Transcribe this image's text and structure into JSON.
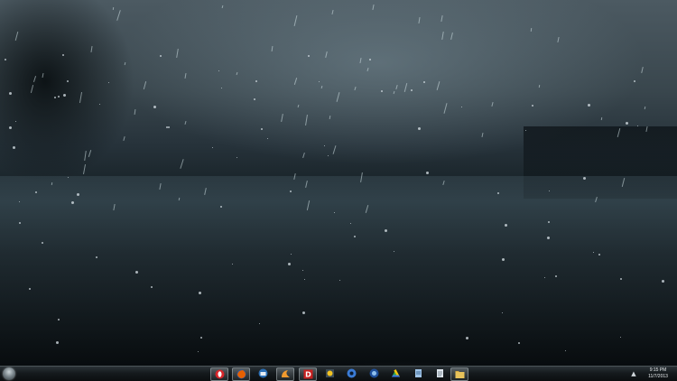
{
  "desktop": {
    "wallpaper": "rain-on-pavement-photo"
  },
  "taskbar": {
    "start_icon": "windows-orb-icon",
    "apps": [
      {
        "name": "opera",
        "icon": "opera-icon",
        "color": "#d6252a"
      },
      {
        "name": "firefox",
        "icon": "firefox-icon",
        "color": "#e66000"
      },
      {
        "name": "thunderbird",
        "icon": "thunderbird-icon",
        "color": "#2b6fb5"
      },
      {
        "name": "app-orange",
        "icon": "orange-swirl-icon",
        "color": "#f29a2e"
      },
      {
        "name": "daemon-tools",
        "icon": "daemon-tools-icon",
        "color": "#c8201f",
        "letter": "D"
      },
      {
        "name": "sun-app",
        "icon": "sun-icon",
        "color": "#f3c321"
      },
      {
        "name": "steam-like",
        "icon": "blue-disc-icon",
        "color": "#3a7bd5"
      },
      {
        "name": "drive",
        "icon": "drive-triangle-icon",
        "color": "#2fa84f"
      },
      {
        "name": "notepad",
        "icon": "notepad-icon",
        "color": "#9fc3e6"
      },
      {
        "name": "documents",
        "icon": "document-icon",
        "color": "#dfe7ee"
      },
      {
        "name": "explorer",
        "icon": "folder-icon",
        "color": "#e8c25a"
      }
    ],
    "tray_arrow": "▲",
    "clock": {
      "time": "9:15 PM",
      "date": "11/7/2013"
    }
  }
}
